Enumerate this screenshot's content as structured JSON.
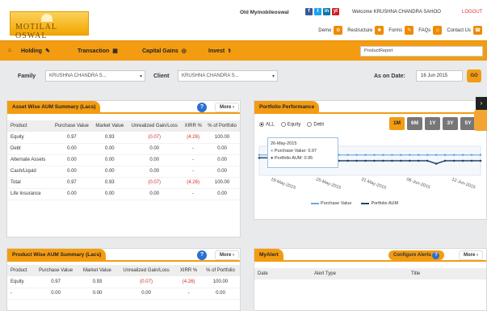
{
  "brand": {
    "logo_text": "MOTILAL OSWAL"
  },
  "header": {
    "old_link": "Old Mymobileoswal",
    "welcome": "Welcome KRUSHNA CHANDRA SAHOO",
    "logout": "LOGOUT",
    "links": [
      {
        "label": "Demo",
        "icon": "gear-icon"
      },
      {
        "label": "Restructure",
        "icon": "tools-icon"
      },
      {
        "label": "Forms",
        "icon": "form-icon"
      },
      {
        "label": "FAQs",
        "icon": "user-icon"
      },
      {
        "label": "Contact Us",
        "icon": "phone-icon"
      }
    ],
    "social": [
      "f",
      "t",
      "in",
      "yt"
    ]
  },
  "nav": {
    "home_icon": "home-icon",
    "items": [
      {
        "label": "Holding",
        "icon": "pencil-icon"
      },
      {
        "label": "Transaction",
        "icon": "grid-icon"
      },
      {
        "label": "Capital Gains",
        "icon": "gain-icon"
      },
      {
        "label": "Invest",
        "icon": "invest-icon"
      }
    ],
    "search_value": "ProductReport"
  },
  "filters": {
    "family_label": "Family",
    "family_value": "KRUSHNA CHANDRA S...",
    "client_label": "Client",
    "client_value": "KRUSHNA CHANDRA S...",
    "date_label": "As on Date:",
    "date_value": "16 Jun 2015",
    "go": "GO"
  },
  "asset_summary": {
    "title": "Asset Wise AUM Summary (Lacs)",
    "more": "More",
    "columns": [
      "Product",
      "Purchase Value",
      "Market Value",
      "Unrealized Gain/Loss",
      "XIRR %",
      "% of Portfolio"
    ],
    "rows": [
      [
        "Equity",
        "0.97",
        "0.93",
        "(0.07)",
        "(4.26)",
        "100.00"
      ],
      [
        "Debt",
        "0.00",
        "0.00",
        "0.00",
        "-",
        "0.00"
      ],
      [
        "Alternate Assets",
        "0.00",
        "0.00",
        "0.00",
        "-",
        "0.00"
      ],
      [
        "Cash/Liquid",
        "0.00",
        "0.00",
        "0.00",
        "-",
        "0.00"
      ],
      [
        "Total",
        "0.97",
        "0.93",
        "(0.07)",
        "(4.26)",
        "100.00"
      ],
      [
        "Life Insurance",
        "0.00",
        "0.00",
        "0.00",
        "-",
        "0.00"
      ]
    ]
  },
  "portfolio": {
    "title": "Portfolio Performance",
    "radio_options": [
      "ALL",
      "Equity",
      "Debt"
    ],
    "ranges": [
      "1M",
      "6M",
      "1Y",
      "3Y",
      "5Y"
    ],
    "active_range": "1M",
    "tooltip_date": "26-May-2015",
    "tooltip_purchase": "Purchase Value: 0.97",
    "tooltip_portfolio": "Portfolio AUM: 0.95",
    "x_labels": [
      "19-May-2015",
      "25-May-2015",
      "31-May-2015",
      "06-Jun-2015",
      "12-Jun-2015"
    ],
    "legend": [
      "Purchase Value",
      "Portfolio AUM"
    ]
  },
  "product_summary": {
    "title": "Product Wise AUM Summary (Lacs)",
    "more": "More",
    "columns": [
      "Product",
      "Purchase Value",
      "Market Value",
      "Unrealized Gain/Loss",
      "XIRR %",
      "% of Portfolio"
    ],
    "rows": [
      [
        "Equity",
        "0.97",
        "0.93",
        "(0.07)",
        "(4.26)",
        "100.00"
      ],
      [
        "-",
        "0.00",
        "0.00",
        "0.00",
        "-",
        "0.00"
      ]
    ]
  },
  "alert": {
    "title": "MyAlert",
    "configure": "Configure Alerts",
    "more": "More",
    "columns": [
      "Date",
      "Alert Type",
      "Title"
    ]
  },
  "chart_data": {
    "type": "line",
    "series": [
      {
        "name": "Purchase Value",
        "values": [
          0.97,
          0.97,
          0.97,
          0.97,
          0.97,
          0.97,
          0.97,
          0.97,
          0.97,
          0.97,
          0.97,
          0.97,
          0.97,
          0.97,
          0.97,
          0.97,
          0.97,
          0.97,
          0.97,
          0.97,
          0.97,
          0.97,
          0.97,
          0.97,
          0.97,
          0.97
        ]
      },
      {
        "name": "Portfolio AUM",
        "values": [
          0.96,
          0.96,
          0.96,
          0.95,
          0.95,
          0.95,
          0.95,
          0.95,
          0.95,
          0.95,
          0.95,
          0.95,
          0.95,
          0.95,
          0.95,
          0.95,
          0.95,
          0.95,
          0.95,
          0.95,
          0.94,
          0.95,
          0.95,
          0.95,
          0.95,
          0.95
        ]
      }
    ],
    "ylim": [
      0,
      1
    ],
    "colors": [
      "#6aa9e0",
      "#24466e"
    ]
  }
}
